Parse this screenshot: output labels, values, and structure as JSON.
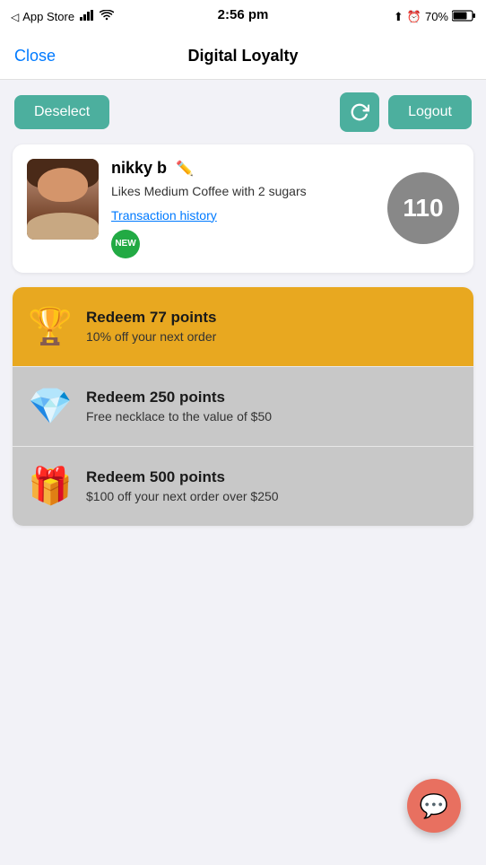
{
  "statusBar": {
    "carrier": "App Store",
    "time": "2:56 pm",
    "battery": "70%"
  },
  "navBar": {
    "closeLabel": "Close",
    "title": "Digital Loyalty"
  },
  "actionBar": {
    "deselectLabel": "Deselect",
    "logoutLabel": "Logout"
  },
  "userCard": {
    "name": "nikky b",
    "preference": "Likes Medium Coffee with 2 sugars",
    "transactionHistory": "Transaction history",
    "points": "110",
    "newBadge": "NEW"
  },
  "rewards": [
    {
      "id": "reward-77",
      "icon": "🏆",
      "title": "Redeem 77 points",
      "subtitle": "10% off your next order",
      "style": "highlight"
    },
    {
      "id": "reward-250",
      "icon": "💎",
      "title": "Redeem 250 points",
      "subtitle": "Free necklace to the value of $50",
      "style": "grey"
    },
    {
      "id": "reward-500",
      "icon": "🎁",
      "title": "Redeem 500 points",
      "subtitle": "$100 off your next order over $250",
      "style": "grey"
    }
  ],
  "fab": {
    "icon": "💬"
  }
}
